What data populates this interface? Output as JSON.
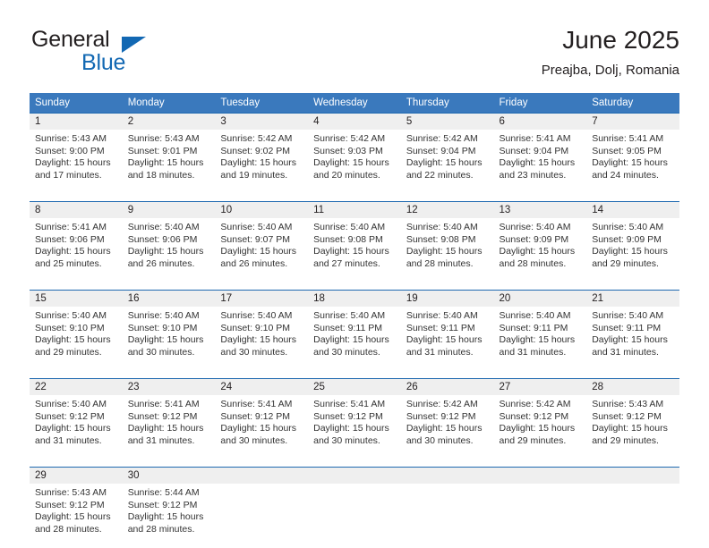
{
  "brand": {
    "name_part1": "General",
    "name_part2": "Blue",
    "logo_icon": "triangle-logo-icon",
    "accent_color": "#1268b3"
  },
  "header": {
    "title": "June 2025",
    "subtitle": "Preajba, Dolj, Romania"
  },
  "calendar": {
    "header_bg": "#3a79bd",
    "daynum_bg": "#efefef",
    "daynum_border": "#1f69b0",
    "weekdays": [
      "Sunday",
      "Monday",
      "Tuesday",
      "Wednesday",
      "Thursday",
      "Friday",
      "Saturday"
    ],
    "weeks": [
      [
        {
          "day": "1",
          "sunrise": "Sunrise: 5:43 AM",
          "sunset": "Sunset: 9:00 PM",
          "daylight_line1": "Daylight: 15 hours",
          "daylight_line2": "and 17 minutes."
        },
        {
          "day": "2",
          "sunrise": "Sunrise: 5:43 AM",
          "sunset": "Sunset: 9:01 PM",
          "daylight_line1": "Daylight: 15 hours",
          "daylight_line2": "and 18 minutes."
        },
        {
          "day": "3",
          "sunrise": "Sunrise: 5:42 AM",
          "sunset": "Sunset: 9:02 PM",
          "daylight_line1": "Daylight: 15 hours",
          "daylight_line2": "and 19 minutes."
        },
        {
          "day": "4",
          "sunrise": "Sunrise: 5:42 AM",
          "sunset": "Sunset: 9:03 PM",
          "daylight_line1": "Daylight: 15 hours",
          "daylight_line2": "and 20 minutes."
        },
        {
          "day": "5",
          "sunrise": "Sunrise: 5:42 AM",
          "sunset": "Sunset: 9:04 PM",
          "daylight_line1": "Daylight: 15 hours",
          "daylight_line2": "and 22 minutes."
        },
        {
          "day": "6",
          "sunrise": "Sunrise: 5:41 AM",
          "sunset": "Sunset: 9:04 PM",
          "daylight_line1": "Daylight: 15 hours",
          "daylight_line2": "and 23 minutes."
        },
        {
          "day": "7",
          "sunrise": "Sunrise: 5:41 AM",
          "sunset": "Sunset: 9:05 PM",
          "daylight_line1": "Daylight: 15 hours",
          "daylight_line2": "and 24 minutes."
        }
      ],
      [
        {
          "day": "8",
          "sunrise": "Sunrise: 5:41 AM",
          "sunset": "Sunset: 9:06 PM",
          "daylight_line1": "Daylight: 15 hours",
          "daylight_line2": "and 25 minutes."
        },
        {
          "day": "9",
          "sunrise": "Sunrise: 5:40 AM",
          "sunset": "Sunset: 9:06 PM",
          "daylight_line1": "Daylight: 15 hours",
          "daylight_line2": "and 26 minutes."
        },
        {
          "day": "10",
          "sunrise": "Sunrise: 5:40 AM",
          "sunset": "Sunset: 9:07 PM",
          "daylight_line1": "Daylight: 15 hours",
          "daylight_line2": "and 26 minutes."
        },
        {
          "day": "11",
          "sunrise": "Sunrise: 5:40 AM",
          "sunset": "Sunset: 9:08 PM",
          "daylight_line1": "Daylight: 15 hours",
          "daylight_line2": "and 27 minutes."
        },
        {
          "day": "12",
          "sunrise": "Sunrise: 5:40 AM",
          "sunset": "Sunset: 9:08 PM",
          "daylight_line1": "Daylight: 15 hours",
          "daylight_line2": "and 28 minutes."
        },
        {
          "day": "13",
          "sunrise": "Sunrise: 5:40 AM",
          "sunset": "Sunset: 9:09 PM",
          "daylight_line1": "Daylight: 15 hours",
          "daylight_line2": "and 28 minutes."
        },
        {
          "day": "14",
          "sunrise": "Sunrise: 5:40 AM",
          "sunset": "Sunset: 9:09 PM",
          "daylight_line1": "Daylight: 15 hours",
          "daylight_line2": "and 29 minutes."
        }
      ],
      [
        {
          "day": "15",
          "sunrise": "Sunrise: 5:40 AM",
          "sunset": "Sunset: 9:10 PM",
          "daylight_line1": "Daylight: 15 hours",
          "daylight_line2": "and 29 minutes."
        },
        {
          "day": "16",
          "sunrise": "Sunrise: 5:40 AM",
          "sunset": "Sunset: 9:10 PM",
          "daylight_line1": "Daylight: 15 hours",
          "daylight_line2": "and 30 minutes."
        },
        {
          "day": "17",
          "sunrise": "Sunrise: 5:40 AM",
          "sunset": "Sunset: 9:10 PM",
          "daylight_line1": "Daylight: 15 hours",
          "daylight_line2": "and 30 minutes."
        },
        {
          "day": "18",
          "sunrise": "Sunrise: 5:40 AM",
          "sunset": "Sunset: 9:11 PM",
          "daylight_line1": "Daylight: 15 hours",
          "daylight_line2": "and 30 minutes."
        },
        {
          "day": "19",
          "sunrise": "Sunrise: 5:40 AM",
          "sunset": "Sunset: 9:11 PM",
          "daylight_line1": "Daylight: 15 hours",
          "daylight_line2": "and 31 minutes."
        },
        {
          "day": "20",
          "sunrise": "Sunrise: 5:40 AM",
          "sunset": "Sunset: 9:11 PM",
          "daylight_line1": "Daylight: 15 hours",
          "daylight_line2": "and 31 minutes."
        },
        {
          "day": "21",
          "sunrise": "Sunrise: 5:40 AM",
          "sunset": "Sunset: 9:11 PM",
          "daylight_line1": "Daylight: 15 hours",
          "daylight_line2": "and 31 minutes."
        }
      ],
      [
        {
          "day": "22",
          "sunrise": "Sunrise: 5:40 AM",
          "sunset": "Sunset: 9:12 PM",
          "daylight_line1": "Daylight: 15 hours",
          "daylight_line2": "and 31 minutes."
        },
        {
          "day": "23",
          "sunrise": "Sunrise: 5:41 AM",
          "sunset": "Sunset: 9:12 PM",
          "daylight_line1": "Daylight: 15 hours",
          "daylight_line2": "and 31 minutes."
        },
        {
          "day": "24",
          "sunrise": "Sunrise: 5:41 AM",
          "sunset": "Sunset: 9:12 PM",
          "daylight_line1": "Daylight: 15 hours",
          "daylight_line2": "and 30 minutes."
        },
        {
          "day": "25",
          "sunrise": "Sunrise: 5:41 AM",
          "sunset": "Sunset: 9:12 PM",
          "daylight_line1": "Daylight: 15 hours",
          "daylight_line2": "and 30 minutes."
        },
        {
          "day": "26",
          "sunrise": "Sunrise: 5:42 AM",
          "sunset": "Sunset: 9:12 PM",
          "daylight_line1": "Daylight: 15 hours",
          "daylight_line2": "and 30 minutes."
        },
        {
          "day": "27",
          "sunrise": "Sunrise: 5:42 AM",
          "sunset": "Sunset: 9:12 PM",
          "daylight_line1": "Daylight: 15 hours",
          "daylight_line2": "and 29 minutes."
        },
        {
          "day": "28",
          "sunrise": "Sunrise: 5:43 AM",
          "sunset": "Sunset: 9:12 PM",
          "daylight_line1": "Daylight: 15 hours",
          "daylight_line2": "and 29 minutes."
        }
      ],
      [
        {
          "day": "29",
          "sunrise": "Sunrise: 5:43 AM",
          "sunset": "Sunset: 9:12 PM",
          "daylight_line1": "Daylight: 15 hours",
          "daylight_line2": "and 28 minutes."
        },
        {
          "day": "30",
          "sunrise": "Sunrise: 5:44 AM",
          "sunset": "Sunset: 9:12 PM",
          "daylight_line1": "Daylight: 15 hours",
          "daylight_line2": "and 28 minutes."
        },
        {
          "day": "",
          "sunrise": "",
          "sunset": "",
          "daylight_line1": "",
          "daylight_line2": ""
        },
        {
          "day": "",
          "sunrise": "",
          "sunset": "",
          "daylight_line1": "",
          "daylight_line2": ""
        },
        {
          "day": "",
          "sunrise": "",
          "sunset": "",
          "daylight_line1": "",
          "daylight_line2": ""
        },
        {
          "day": "",
          "sunrise": "",
          "sunset": "",
          "daylight_line1": "",
          "daylight_line2": ""
        },
        {
          "day": "",
          "sunrise": "",
          "sunset": "",
          "daylight_line1": "",
          "daylight_line2": ""
        }
      ]
    ]
  }
}
